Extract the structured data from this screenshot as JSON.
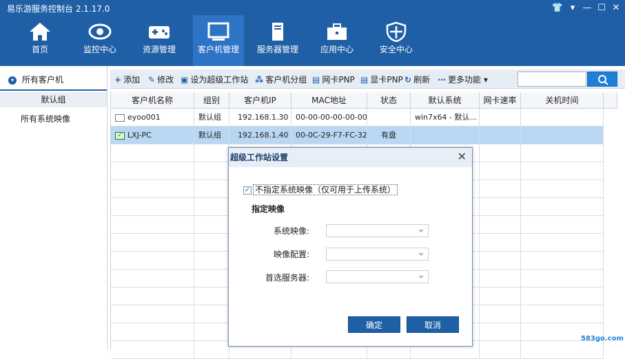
{
  "app": {
    "title": "易乐游服务控制台 2.1.17.0"
  },
  "nav": [
    {
      "label": "首页"
    },
    {
      "label": "监控中心"
    },
    {
      "label": "资源管理"
    },
    {
      "label": "客户机管理"
    },
    {
      "label": "服务器管理"
    },
    {
      "label": "应用中心"
    },
    {
      "label": "安全中心"
    }
  ],
  "sidebar": {
    "all_clients": "所有客户机",
    "default_group": "默认组",
    "all_images": "所有系统映像"
  },
  "toolbar": {
    "add": "添加",
    "edit": "修改",
    "set_super": "设为超级工作站",
    "group": "客户机分组",
    "nic_pnp": "网卡PNP",
    "gpu_pnp": "显卡PNP",
    "refresh": "刷新",
    "more": "更多功能"
  },
  "table": {
    "columns": [
      "客户机名称",
      "组别",
      "客户机IP",
      "MAC地址",
      "状态",
      "默认系统",
      "网卡速率",
      "关机时间"
    ],
    "rows": [
      {
        "name": "eyoo001",
        "group": "默认组",
        "ip": "192.168.1.30",
        "mac": "00-00-00-00-00-00",
        "status": "",
        "os": "win7x64 - 默认...",
        "speed": "",
        "off": ""
      },
      {
        "name": "LXJ-PC",
        "group": "默认组",
        "ip": "192.168.1.40",
        "mac": "00-0C-29-F7-FC-32",
        "status": "有盘",
        "os": "",
        "speed": "",
        "off": ""
      }
    ]
  },
  "dialog": {
    "title": "超级工作站设置",
    "checkbox_label": "不指定系统映像（仅可用于上传系统）",
    "checkbox_checked": true,
    "section_label": "指定映像",
    "field_image": "系统映像:",
    "field_config": "映像配置:",
    "field_server": "首选服务器:",
    "ok": "确定",
    "cancel": "取消"
  },
  "watermark": "583go.com",
  "colors": {
    "titlebar": "#1f5fa6",
    "active_nav": "#2e74c6",
    "selected_row": "#b9d6f2"
  }
}
